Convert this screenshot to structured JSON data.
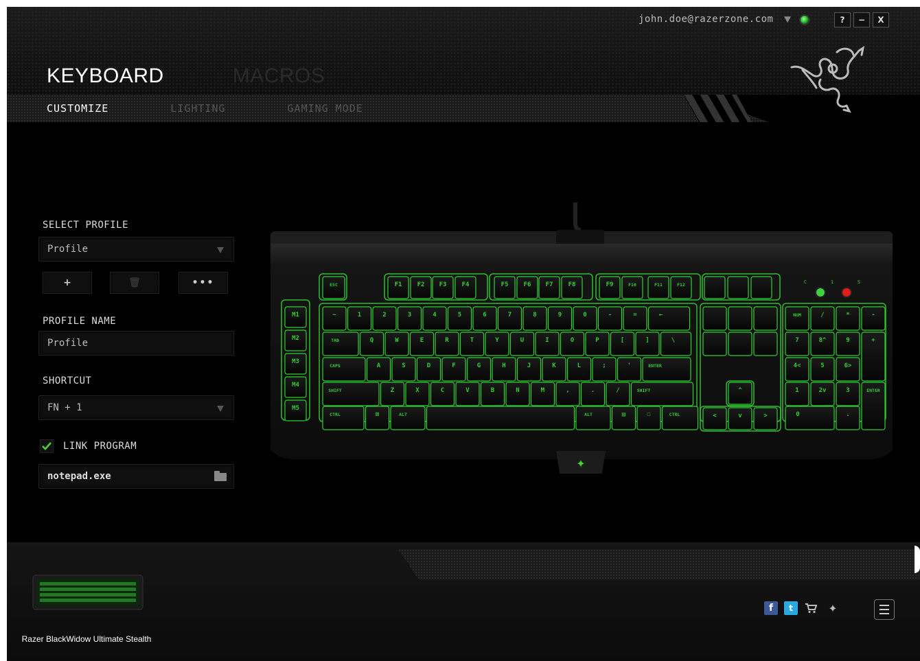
{
  "header": {
    "user_email": "john.doe@razerzone.com",
    "window_buttons": [
      "?",
      "−",
      "X"
    ],
    "main_tabs": [
      {
        "label": "KEYBOARD",
        "active": true
      },
      {
        "label": "MACROS",
        "active": false
      }
    ],
    "sub_tabs": [
      {
        "label": "CUSTOMIZE",
        "active": true
      },
      {
        "label": "LIGHTING",
        "active": false
      },
      {
        "label": "GAMING MODE",
        "active": false
      }
    ]
  },
  "profile_panel": {
    "select_profile_label": "SELECT PROFILE",
    "selected_profile": "Profile",
    "buttons": [
      "+",
      "🗑",
      "•••"
    ],
    "profile_name_label": "PROFILE NAME",
    "profile_name_value": "Profile",
    "shortcut_label": "SHORTCUT",
    "shortcut_value": "FN + 1",
    "link_program_label": "LINK PROGRAM",
    "link_program_checked": true,
    "program_value": "notepad.exe"
  },
  "keyboard": {
    "macro_keys": [
      "M1",
      "M2",
      "M3",
      "M4",
      "M5"
    ],
    "indicator_labels": [
      "C",
      "1",
      "S"
    ],
    "rows": [
      [
        "ESC",
        "F1",
        "F2",
        "F3",
        "F4",
        "F5",
        "F6",
        "F7",
        "F8",
        "F9",
        "F10",
        "F11",
        "F12"
      ],
      [
        "~",
        "1",
        "2",
        "3",
        "4",
        "5",
        "6",
        "7",
        "8",
        "9",
        "0",
        "-",
        "=",
        "←"
      ],
      [
        "TAB",
        "Q",
        "W",
        "E",
        "R",
        "T",
        "Y",
        "U",
        "I",
        "O",
        "P",
        "[",
        "]",
        "\\"
      ],
      [
        "CAPS",
        "A",
        "S",
        "D",
        "F",
        "G",
        "H",
        "J",
        "K",
        "L",
        ";",
        "'",
        "ENTER"
      ],
      [
        "SHIFT",
        "Z",
        "X",
        "C",
        "V",
        "B",
        "N",
        "M",
        ",",
        ".",
        "/",
        "SHIFT"
      ],
      [
        "CTRL",
        "⊞",
        "ALT",
        "",
        "ALT",
        "▤",
        "☐",
        "CTRL"
      ]
    ],
    "arrows": [
      "^",
      "<",
      "v",
      ">"
    ],
    "numpad": [
      [
        "NUM",
        "/",
        "*",
        "-"
      ],
      [
        "7",
        "8^",
        "9",
        "+"
      ],
      [
        "4<",
        "5",
        "6>"
      ],
      [
        "1",
        "2v",
        "3",
        "ENTER"
      ],
      [
        "0",
        "."
      ]
    ]
  },
  "footer": {
    "device_name": "Razer BlackWidow Ultimate Stealth",
    "social_icons": [
      "facebook-icon",
      "twitter-icon",
      "store-icon",
      "razer-icon"
    ]
  },
  "colors": {
    "accent_green": "#44d62c",
    "key_glow": "#2fd12f",
    "background": "#000000"
  }
}
